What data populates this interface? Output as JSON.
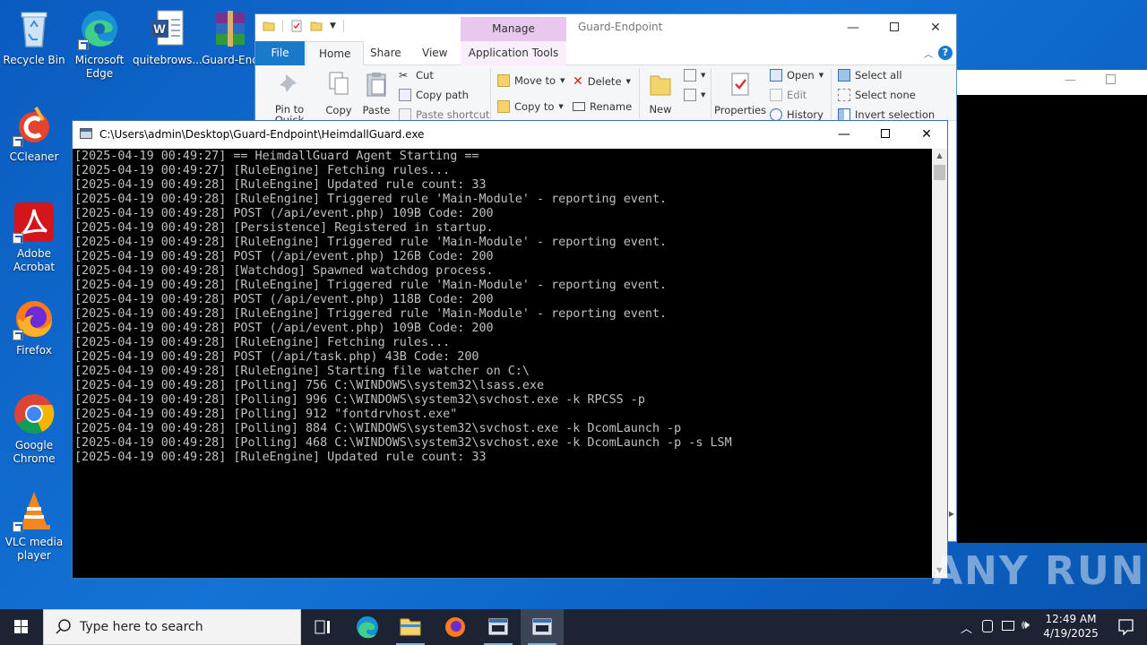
{
  "desktop": {
    "icons": [
      {
        "label": "Recycle Bin"
      },
      {
        "label": "Microsoft Edge"
      },
      {
        "label": "quitebrows..."
      },
      {
        "label": "Guard-End"
      },
      {
        "label": "CCleaner"
      },
      {
        "label": "Adobe Acrobat"
      },
      {
        "label": "Firefox"
      },
      {
        "label": "Google Chrome"
      },
      {
        "label": "VLC media player"
      }
    ]
  },
  "explorer": {
    "title": "Guard-Endpoint",
    "manage_tab": "Manage",
    "tabs": {
      "file": "File",
      "home": "Home",
      "share": "Share",
      "view": "View",
      "app_tools": "Application Tools"
    },
    "ribbon": {
      "pin": "Pin to Quick access",
      "copy": "Copy",
      "paste": "Paste",
      "cut": "Cut",
      "copy_path": "Copy path",
      "paste_shortcut": "Paste shortcut",
      "move_to": "Move to",
      "copy_to": "Copy to",
      "delete": "Delete",
      "rename": "Rename",
      "new_folder": "New folder",
      "properties": "Properties",
      "open": "Open",
      "edit": "Edit",
      "history": "History",
      "select_all": "Select all",
      "select_none": "Select none",
      "invert_selection": "Invert selection"
    }
  },
  "console": {
    "title": "C:\\Users\\admin\\Desktop\\Guard-Endpoint\\HeimdallGuard.exe",
    "lines": [
      "[2025-04-19 00:49:27] == HeimdallGuard Agent Starting ==",
      "[2025-04-19 00:49:27] [RuleEngine] Fetching rules...",
      "[2025-04-19 00:49:28] [RuleEngine] Updated rule count: 33",
      "[2025-04-19 00:49:28] [RuleEngine] Triggered rule 'Main-Module' - reporting event.",
      "[2025-04-19 00:49:28] POST (/api/event.php) 109B Code: 200",
      "[2025-04-19 00:49:28] [Persistence] Registered in startup.",
      "[2025-04-19 00:49:28] [RuleEngine] Triggered rule 'Main-Module' - reporting event.",
      "[2025-04-19 00:49:28] POST (/api/event.php) 126B Code: 200",
      "[2025-04-19 00:49:28] [Watchdog] Spawned watchdog process.",
      "[2025-04-19 00:49:28] [RuleEngine] Triggered rule 'Main-Module' - reporting event.",
      "[2025-04-19 00:49:28] POST (/api/event.php) 118B Code: 200",
      "[2025-04-19 00:49:28] [RuleEngine] Triggered rule 'Main-Module' - reporting event.",
      "[2025-04-19 00:49:28] POST (/api/event.php) 109B Code: 200",
      "[2025-04-19 00:49:28] [RuleEngine] Fetching rules...",
      "[2025-04-19 00:49:28] POST (/api/task.php) 43B Code: 200",
      "[2025-04-19 00:49:28] [RuleEngine] Starting file watcher on C:\\",
      "[2025-04-19 00:49:28] [Polling] 756 C:\\WINDOWS\\system32\\lsass.exe",
      "[2025-04-19 00:49:28] [Polling] 996 C:\\WINDOWS\\system32\\svchost.exe -k RPCSS -p",
      "[2025-04-19 00:49:28] [Polling] 912 \"fontdrvhost.exe\"",
      "[2025-04-19 00:49:28] [Polling] 884 C:\\WINDOWS\\system32\\svchost.exe -k DcomLaunch -p",
      "[2025-04-19 00:49:28] [Polling] 468 C:\\WINDOWS\\system32\\svchost.exe -k DcomLaunch -p -s LSM",
      "[2025-04-19 00:49:28] [RuleEngine] Updated rule count: 33"
    ]
  },
  "taskbar": {
    "search_placeholder": "Type here to search",
    "time": "12:49 AM",
    "date": "4/19/2025"
  },
  "watermark": "ANY RUN",
  "colors": {
    "desktop": "#1066cc",
    "taskbar": "#1c2433",
    "file_tab": "#1979ca",
    "manage": "#e9c8ef",
    "console_text": "#c0c0c0"
  }
}
